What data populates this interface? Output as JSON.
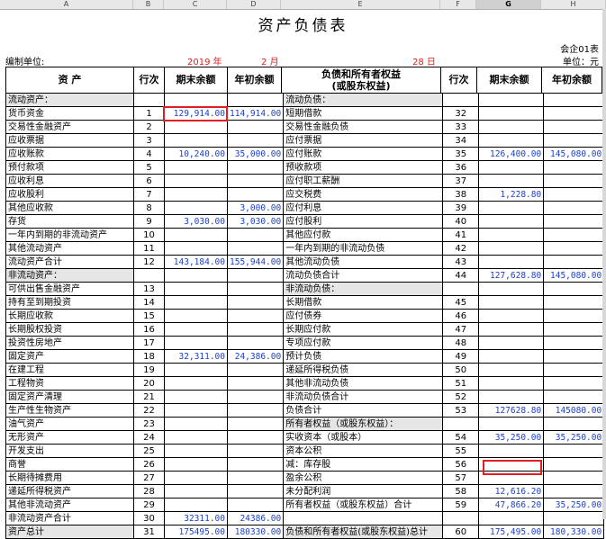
{
  "columns": [
    "A",
    "B",
    "C",
    "D",
    "E",
    "F",
    "G",
    "H"
  ],
  "selected_column": "G",
  "title": "资产负债表",
  "company_code": "会企01表",
  "unit": "单位：元",
  "prepared_by": "编制单位:",
  "date": {
    "year": "2019",
    "year_unit": "年",
    "month": "2",
    "month_unit": "月",
    "day": "28",
    "day_unit": "日"
  },
  "header": {
    "asset": "资    产",
    "row_no": "行次",
    "end": "期末余额",
    "begin": "年初余额",
    "liab": "负债和所有者权益\n(或股东权益)",
    "row_no2": "行次",
    "end2": "期末余额",
    "begin2": "年初余额"
  },
  "rows": [
    [
      "流动资产：",
      "",
      "",
      "",
      "流动负债：",
      "",
      "",
      ""
    ],
    [
      "  货币资金",
      "1",
      "129,914.00",
      "114,914.00",
      "  短期借款",
      "32",
      "",
      ""
    ],
    [
      "  交易性金融资产",
      "2",
      "",
      "",
      "  交易性金融负债",
      "33",
      "",
      ""
    ],
    [
      "  应收票据",
      "3",
      "",
      "",
      "  应付票据",
      "34",
      "",
      ""
    ],
    [
      "  应收账款",
      "4",
      "10,240.00",
      "35,000.00",
      "  应付账款",
      "35",
      "126,400.00",
      "145,080.00"
    ],
    [
      "  预付款项",
      "5",
      "",
      "",
      "  预收款项",
      "36",
      "",
      ""
    ],
    [
      "  应收利息",
      "6",
      "",
      "",
      "  应付职工薪酬",
      "37",
      "",
      ""
    ],
    [
      "  应收股利",
      "7",
      "",
      "",
      "  应交税费",
      "38",
      "1,228.80",
      ""
    ],
    [
      "  其他应收款",
      "8",
      "",
      "3,000.00",
      "  应付利息",
      "39",
      "",
      ""
    ],
    [
      "  存货",
      "9",
      "3,030.00",
      "3,030.00",
      "  应付股利",
      "40",
      "",
      ""
    ],
    [
      "  一年内到期的非流动资产",
      "10",
      "",
      "",
      "  其他应付款",
      "41",
      "",
      ""
    ],
    [
      "  其他流动资产",
      "11",
      "",
      "",
      "  一年内到期的非流动负债",
      "42",
      "",
      ""
    ],
    [
      "    流动资产合计",
      "12",
      "143,184.00",
      "155,944.00",
      "  其他流动负债",
      "43",
      "",
      ""
    ],
    [
      "非流动资产：",
      "",
      "",
      "",
      "      流动负债合计",
      "44",
      "127,628.80",
      "145,080.00"
    ],
    [
      "  可供出售金融资产",
      "13",
      "",
      "",
      "非流动负债：",
      "",
      "",
      ""
    ],
    [
      "  持有至到期投资",
      "14",
      "",
      "",
      "  长期借款",
      "45",
      "",
      ""
    ],
    [
      "  长期应收款",
      "15",
      "",
      "",
      "  应付债券",
      "46",
      "",
      ""
    ],
    [
      "  长期股权投资",
      "16",
      "",
      "",
      "  长期应付款",
      "47",
      "",
      ""
    ],
    [
      "  投资性房地产",
      "17",
      "",
      "",
      "  专项应付款",
      "48",
      "",
      ""
    ],
    [
      "  固定资产",
      "18",
      "32,311.00",
      "24,386.00",
      "  预计负债",
      "49",
      "",
      ""
    ],
    [
      "  在建工程",
      "19",
      "",
      "",
      "  递延所得税负债",
      "50",
      "",
      ""
    ],
    [
      "  工程物资",
      "20",
      "",
      "",
      "  其他非流动负债",
      "51",
      "",
      ""
    ],
    [
      "  固定资产清理",
      "21",
      "",
      "",
      "      非流动负债合计",
      "52",
      "",
      ""
    ],
    [
      "  生产性生物资产",
      "22",
      "",
      "",
      "        负债合计",
      "53",
      "127628.80",
      "145080.00"
    ],
    [
      "  油气资产",
      "23",
      "",
      "",
      "所有者权益（或股东权益）：",
      "",
      "",
      ""
    ],
    [
      "  无形资产",
      "24",
      "",
      "",
      "  实收资本（或股本）",
      "54",
      "35,250.00",
      "35,250.00"
    ],
    [
      "  开发支出",
      "25",
      "",
      "",
      "  资本公积",
      "55",
      "",
      ""
    ],
    [
      "  商誉",
      "26",
      "",
      "",
      "  减：库存股",
      "56",
      "",
      ""
    ],
    [
      "  长期待摊费用",
      "27",
      "",
      "",
      "  盈余公积",
      "57",
      "",
      ""
    ],
    [
      "  递延所得税资产",
      "28",
      "",
      "",
      "  未分配利润",
      "58",
      "12,616.20",
      ""
    ],
    [
      "  其他非流动资产",
      "29",
      "",
      "",
      "所有者权益（或股东权益）合计",
      "59",
      "47,866.20",
      "35,250.00"
    ],
    [
      "    非流动资产合计",
      "30",
      "32311.00",
      "24386.00",
      "",
      "",
      "",
      ""
    ],
    [
      "        资产总计",
      "31",
      "175495.00",
      "180330.00",
      "负债和所有者权益(或股东权益)总计",
      "60",
      "175,495.00",
      "180,330.00"
    ]
  ]
}
